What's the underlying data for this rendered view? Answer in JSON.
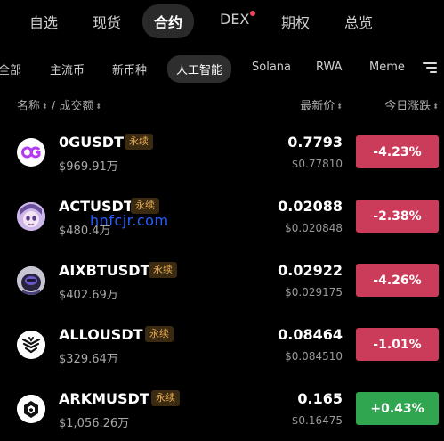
{
  "top_tabs": {
    "watchlist": "自选",
    "spot": "现货",
    "contract": "合约",
    "dex": "DEX",
    "options": "期权",
    "overview": "总览"
  },
  "category_tabs": {
    "all": "全部",
    "mainstream": "主流币",
    "newcoins": "新币种",
    "ai": "人工智能",
    "solana": "Solana",
    "rwa": "RWA",
    "meme": "Meme"
  },
  "columns": {
    "name": "名称",
    "sep": " / ",
    "volume": "成交额",
    "price": "最新价",
    "change": "今日涨跌"
  },
  "rows": [
    {
      "symbol": "0GUSDT",
      "tag": "永续",
      "volume": "$969.91万",
      "price": "0.7793",
      "index_price": "$0.77810",
      "change": "-4.23%"
    },
    {
      "symbol": "ACTUSDT",
      "tag": "永续",
      "volume": "$480.4万",
      "price": "0.02088",
      "index_price": "$0.020848",
      "change": "-2.38%"
    },
    {
      "symbol": "AIXBTUSDT",
      "tag": "永续",
      "volume": "$402.69万",
      "price": "0.02922",
      "index_price": "$0.029175",
      "change": "-4.26%"
    },
    {
      "symbol": "ALLOUSDT",
      "tag": "永续",
      "volume": "$329.64万",
      "price": "0.08464",
      "index_price": "$0.084510",
      "change": "-1.01%"
    },
    {
      "symbol": "ARKMUSDT",
      "tag": "永续",
      "volume": "$1,056.26万",
      "price": "0.165",
      "index_price": "$0.16475",
      "change": "+0.43%"
    }
  ],
  "watermark": "hnfcjr.com",
  "colors": {
    "down": "#ca3c59",
    "up": "#2fa64f",
    "tag_text": "#e5a84f",
    "background": "#000000"
  }
}
